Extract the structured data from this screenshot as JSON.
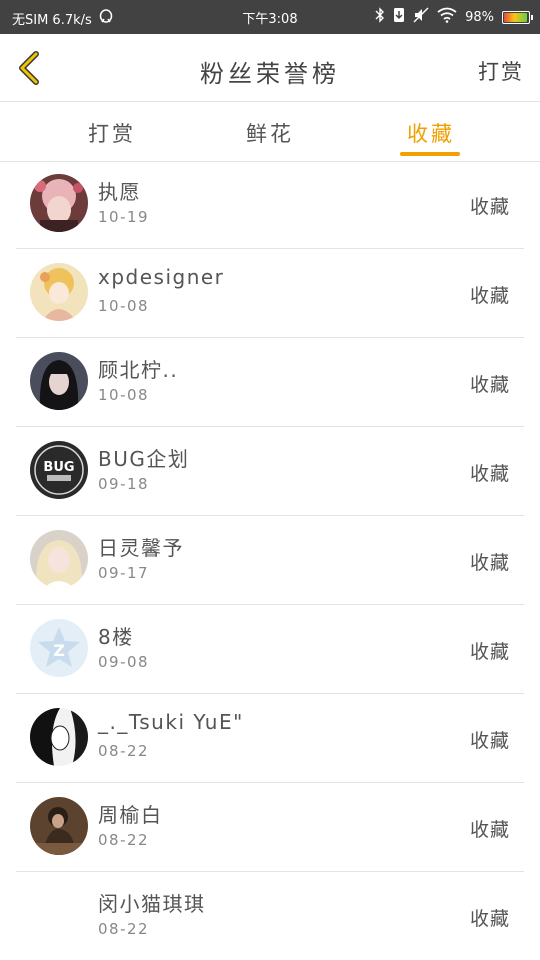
{
  "status_bar": {
    "carrier": "无SIM 6.7k/s",
    "time": "下午3:08",
    "battery_text": "98%",
    "battery_level": 0.98
  },
  "nav": {
    "title": "粉丝荣誉榜",
    "right_label": "打赏"
  },
  "tabs": [
    {
      "label": "打赏",
      "active": false
    },
    {
      "label": "鲜花",
      "active": false
    },
    {
      "label": "收藏",
      "active": true
    }
  ],
  "colors": {
    "accent": "#f0a000",
    "status_bar": "#424242",
    "back_arrow": "#f5c400",
    "text": "#555555",
    "divider": "#e3e3e3"
  },
  "list": [
    {
      "name": "执愿",
      "date": "10-19",
      "action": "收藏",
      "avatar": "photo-girl-pink"
    },
    {
      "name": "xpdesigner",
      "date": "10-08",
      "action": "收藏",
      "avatar": "photo-doll"
    },
    {
      "name": "顾北柠..",
      "date": "10-08",
      "action": "收藏",
      "avatar": "photo-girl-dark-hair"
    },
    {
      "name": "BUG企划",
      "date": "09-18",
      "action": "收藏",
      "avatar": "logo-bug"
    },
    {
      "name": "日灵馨予",
      "date": "09-17",
      "action": "收藏",
      "avatar": "photo-girl-blonde"
    },
    {
      "name": "8楼",
      "date": "09-08",
      "action": "收藏",
      "avatar": "default-star-z"
    },
    {
      "name": "_._Tsuki YuE\"",
      "date": "08-22",
      "action": "收藏",
      "avatar": "photo-bw-face"
    },
    {
      "name": "周榆白",
      "date": "08-22",
      "action": "收藏",
      "avatar": "photo-sitting-girl"
    },
    {
      "name": "闵小猫琪琪",
      "date": "08-22",
      "action": "收藏",
      "avatar": "blank"
    }
  ]
}
